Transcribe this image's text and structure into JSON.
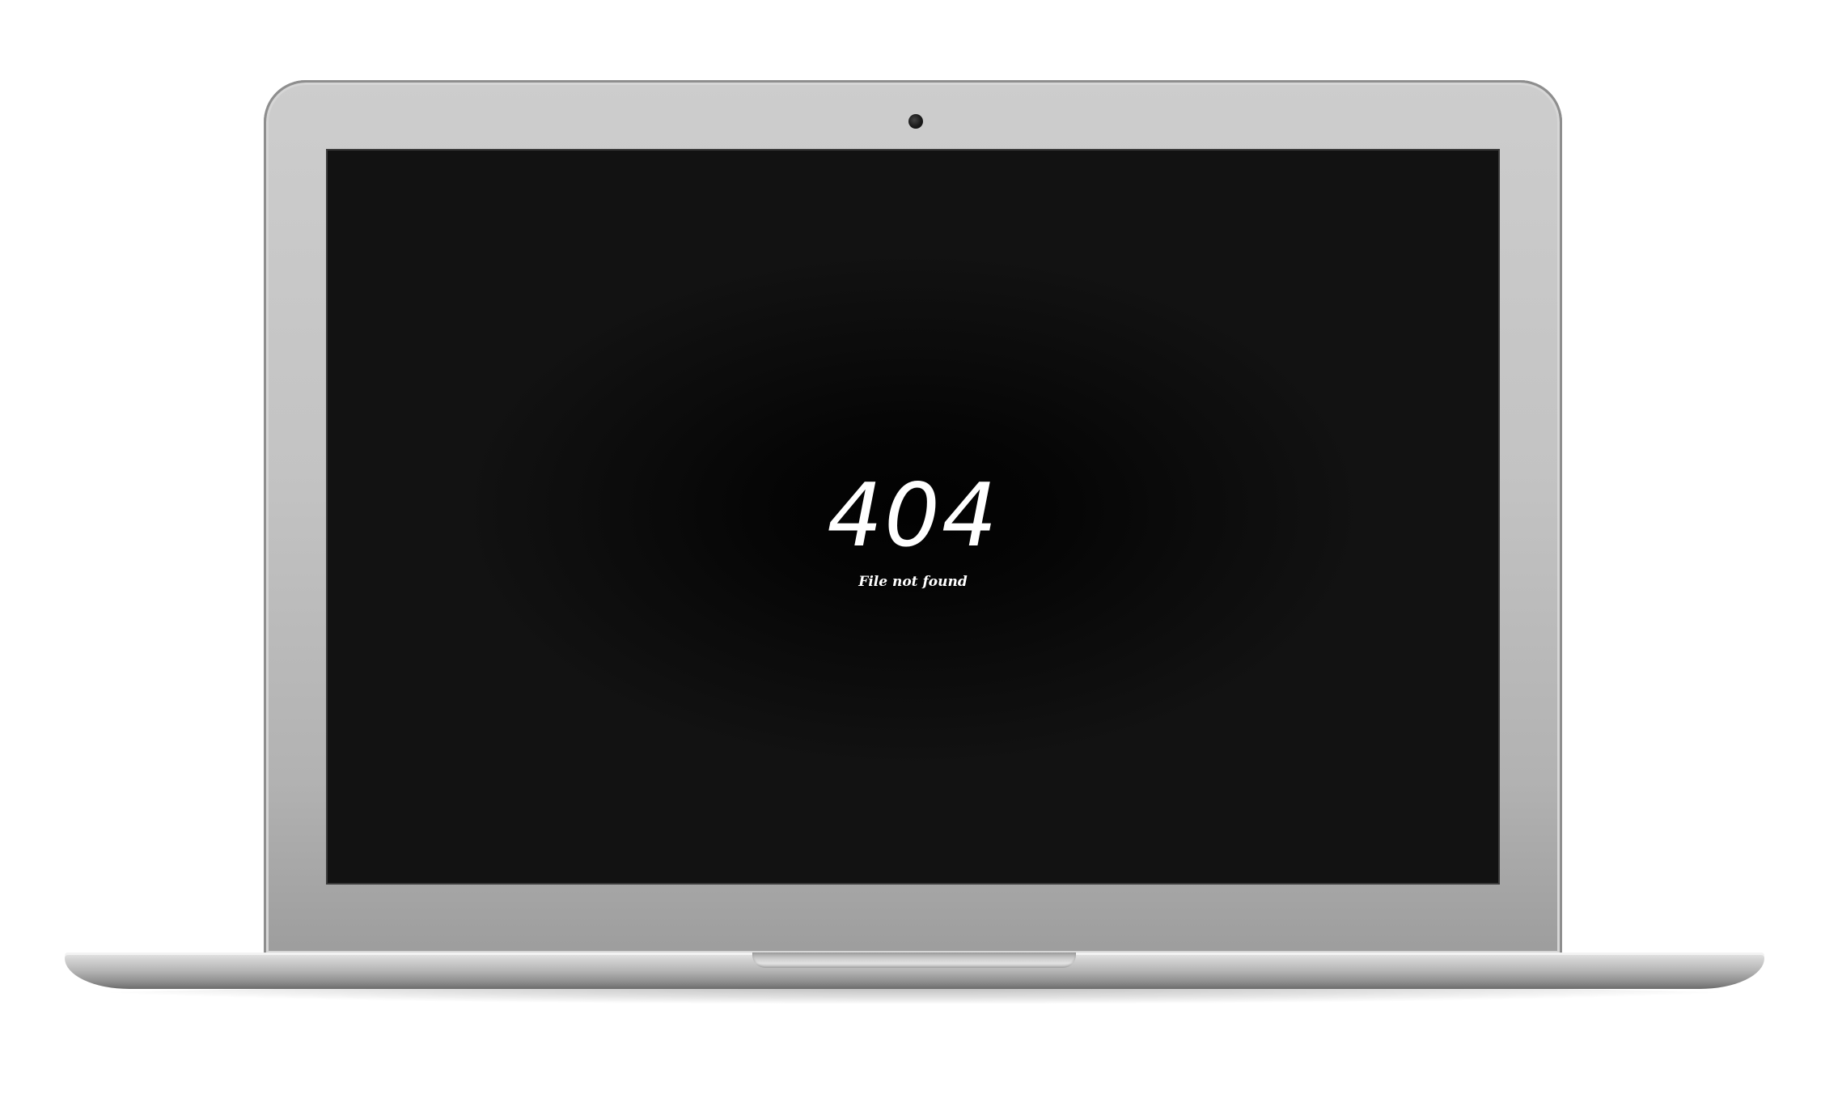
{
  "screen": {
    "error_code": "404",
    "error_message": "File not found"
  },
  "icons": {
    "camera": "webcam-icon"
  },
  "colors": {
    "screen_background": "#121212",
    "screen_center": "#020202",
    "text": "#ffffff",
    "laptop_body": "#c6c6c6"
  }
}
